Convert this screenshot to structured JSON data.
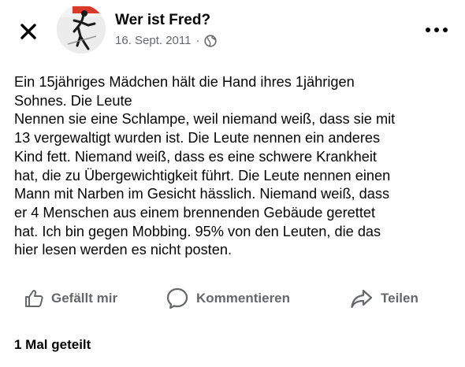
{
  "post": {
    "author": "Wer ist Fred?",
    "date": "16. Sept. 2011",
    "separator": "·",
    "avatar_text": "Wer ist Fred",
    "body": "Ein 15jähriges Mädchen hält die Hand ihres 1jährigen\nSohnes. Die Leute\nNennen sie eine Schlampe, weil niemand weiß, dass sie mit\n13 vergewaltigt wurden ist. Die Leute nennen ein anderes\nKind fett. Niemand weiß, dass es eine schwere Krankheit\nhat, die zu Übergewichtigkeit führt. Die Leute nennen einen\nMann mit Narben im Gesicht hässlich. Niemand weiß, dass\ner 4 Menschen aus einem brennenden Gebäude gerettet\nhat. Ich bin gegen Mobbing. 95% von den Leuten, die das\nhier lesen werden es nicht posten."
  },
  "actions": {
    "like_label": "Gefällt mir",
    "comment_label": "Kommentieren",
    "share_label": "Teilen"
  },
  "footer": {
    "shares_text": "1 Mal geteilt"
  },
  "icons": {
    "close": "close-icon",
    "more": "more-dots-icon",
    "privacy": "globe-icon",
    "like": "thumbs-up-icon",
    "comment": "comment-bubble-icon",
    "share": "share-arrow-icon"
  },
  "colors": {
    "text_primary": "#050505",
    "text_secondary": "#65676b",
    "background": "#ffffff",
    "avatar_accent": "#d93a2b"
  }
}
